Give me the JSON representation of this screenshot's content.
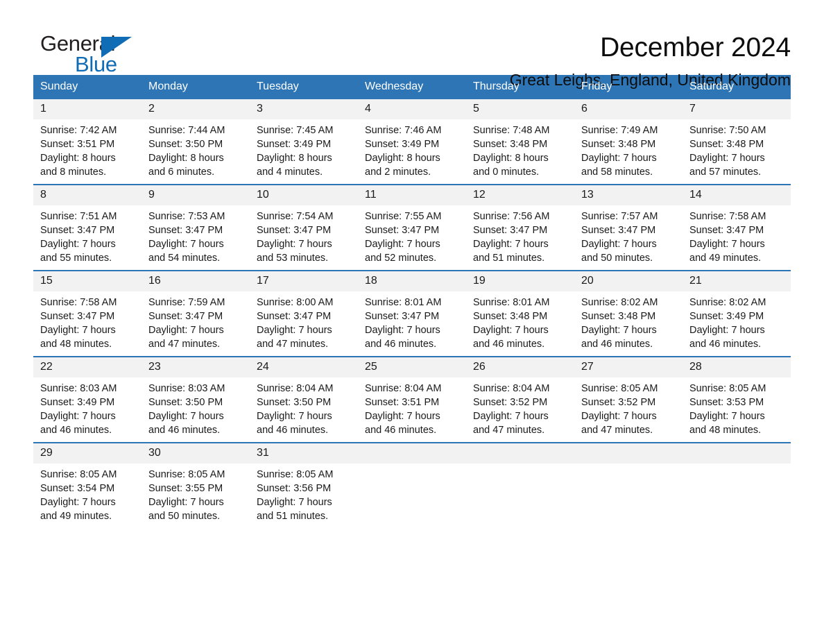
{
  "brand": {
    "name_dark": "General",
    "name_blue": "Blue",
    "accent_color": "#0f6cb5"
  },
  "header": {
    "title": "December 2024",
    "location": "Great Leighs, England, United Kingdom"
  },
  "calendar": {
    "header_color": "#2e75b6",
    "day_band_color": "#f2f2f2",
    "weekdays": [
      "Sunday",
      "Monday",
      "Tuesday",
      "Wednesday",
      "Thursday",
      "Friday",
      "Saturday"
    ],
    "weeks": [
      [
        {
          "day": "1",
          "sunrise": "Sunrise: 7:42 AM",
          "sunset": "Sunset: 3:51 PM",
          "daylight_1": "Daylight: 8 hours",
          "daylight_2": "and 8 minutes."
        },
        {
          "day": "2",
          "sunrise": "Sunrise: 7:44 AM",
          "sunset": "Sunset: 3:50 PM",
          "daylight_1": "Daylight: 8 hours",
          "daylight_2": "and 6 minutes."
        },
        {
          "day": "3",
          "sunrise": "Sunrise: 7:45 AM",
          "sunset": "Sunset: 3:49 PM",
          "daylight_1": "Daylight: 8 hours",
          "daylight_2": "and 4 minutes."
        },
        {
          "day": "4",
          "sunrise": "Sunrise: 7:46 AM",
          "sunset": "Sunset: 3:49 PM",
          "daylight_1": "Daylight: 8 hours",
          "daylight_2": "and 2 minutes."
        },
        {
          "day": "5",
          "sunrise": "Sunrise: 7:48 AM",
          "sunset": "Sunset: 3:48 PM",
          "daylight_1": "Daylight: 8 hours",
          "daylight_2": "and 0 minutes."
        },
        {
          "day": "6",
          "sunrise": "Sunrise: 7:49 AM",
          "sunset": "Sunset: 3:48 PM",
          "daylight_1": "Daylight: 7 hours",
          "daylight_2": "and 58 minutes."
        },
        {
          "day": "7",
          "sunrise": "Sunrise: 7:50 AM",
          "sunset": "Sunset: 3:48 PM",
          "daylight_1": "Daylight: 7 hours",
          "daylight_2": "and 57 minutes."
        }
      ],
      [
        {
          "day": "8",
          "sunrise": "Sunrise: 7:51 AM",
          "sunset": "Sunset: 3:47 PM",
          "daylight_1": "Daylight: 7 hours",
          "daylight_2": "and 55 minutes."
        },
        {
          "day": "9",
          "sunrise": "Sunrise: 7:53 AM",
          "sunset": "Sunset: 3:47 PM",
          "daylight_1": "Daylight: 7 hours",
          "daylight_2": "and 54 minutes."
        },
        {
          "day": "10",
          "sunrise": "Sunrise: 7:54 AM",
          "sunset": "Sunset: 3:47 PM",
          "daylight_1": "Daylight: 7 hours",
          "daylight_2": "and 53 minutes."
        },
        {
          "day": "11",
          "sunrise": "Sunrise: 7:55 AM",
          "sunset": "Sunset: 3:47 PM",
          "daylight_1": "Daylight: 7 hours",
          "daylight_2": "and 52 minutes."
        },
        {
          "day": "12",
          "sunrise": "Sunrise: 7:56 AM",
          "sunset": "Sunset: 3:47 PM",
          "daylight_1": "Daylight: 7 hours",
          "daylight_2": "and 51 minutes."
        },
        {
          "day": "13",
          "sunrise": "Sunrise: 7:57 AM",
          "sunset": "Sunset: 3:47 PM",
          "daylight_1": "Daylight: 7 hours",
          "daylight_2": "and 50 minutes."
        },
        {
          "day": "14",
          "sunrise": "Sunrise: 7:58 AM",
          "sunset": "Sunset: 3:47 PM",
          "daylight_1": "Daylight: 7 hours",
          "daylight_2": "and 49 minutes."
        }
      ],
      [
        {
          "day": "15",
          "sunrise": "Sunrise: 7:58 AM",
          "sunset": "Sunset: 3:47 PM",
          "daylight_1": "Daylight: 7 hours",
          "daylight_2": "and 48 minutes."
        },
        {
          "day": "16",
          "sunrise": "Sunrise: 7:59 AM",
          "sunset": "Sunset: 3:47 PM",
          "daylight_1": "Daylight: 7 hours",
          "daylight_2": "and 47 minutes."
        },
        {
          "day": "17",
          "sunrise": "Sunrise: 8:00 AM",
          "sunset": "Sunset: 3:47 PM",
          "daylight_1": "Daylight: 7 hours",
          "daylight_2": "and 47 minutes."
        },
        {
          "day": "18",
          "sunrise": "Sunrise: 8:01 AM",
          "sunset": "Sunset: 3:47 PM",
          "daylight_1": "Daylight: 7 hours",
          "daylight_2": "and 46 minutes."
        },
        {
          "day": "19",
          "sunrise": "Sunrise: 8:01 AM",
          "sunset": "Sunset: 3:48 PM",
          "daylight_1": "Daylight: 7 hours",
          "daylight_2": "and 46 minutes."
        },
        {
          "day": "20",
          "sunrise": "Sunrise: 8:02 AM",
          "sunset": "Sunset: 3:48 PM",
          "daylight_1": "Daylight: 7 hours",
          "daylight_2": "and 46 minutes."
        },
        {
          "day": "21",
          "sunrise": "Sunrise: 8:02 AM",
          "sunset": "Sunset: 3:49 PM",
          "daylight_1": "Daylight: 7 hours",
          "daylight_2": "and 46 minutes."
        }
      ],
      [
        {
          "day": "22",
          "sunrise": "Sunrise: 8:03 AM",
          "sunset": "Sunset: 3:49 PM",
          "daylight_1": "Daylight: 7 hours",
          "daylight_2": "and 46 minutes."
        },
        {
          "day": "23",
          "sunrise": "Sunrise: 8:03 AM",
          "sunset": "Sunset: 3:50 PM",
          "daylight_1": "Daylight: 7 hours",
          "daylight_2": "and 46 minutes."
        },
        {
          "day": "24",
          "sunrise": "Sunrise: 8:04 AM",
          "sunset": "Sunset: 3:50 PM",
          "daylight_1": "Daylight: 7 hours",
          "daylight_2": "and 46 minutes."
        },
        {
          "day": "25",
          "sunrise": "Sunrise: 8:04 AM",
          "sunset": "Sunset: 3:51 PM",
          "daylight_1": "Daylight: 7 hours",
          "daylight_2": "and 46 minutes."
        },
        {
          "day": "26",
          "sunrise": "Sunrise: 8:04 AM",
          "sunset": "Sunset: 3:52 PM",
          "daylight_1": "Daylight: 7 hours",
          "daylight_2": "and 47 minutes."
        },
        {
          "day": "27",
          "sunrise": "Sunrise: 8:05 AM",
          "sunset": "Sunset: 3:52 PM",
          "daylight_1": "Daylight: 7 hours",
          "daylight_2": "and 47 minutes."
        },
        {
          "day": "28",
          "sunrise": "Sunrise: 8:05 AM",
          "sunset": "Sunset: 3:53 PM",
          "daylight_1": "Daylight: 7 hours",
          "daylight_2": "and 48 minutes."
        }
      ],
      [
        {
          "day": "29",
          "sunrise": "Sunrise: 8:05 AM",
          "sunset": "Sunset: 3:54 PM",
          "daylight_1": "Daylight: 7 hours",
          "daylight_2": "and 49 minutes."
        },
        {
          "day": "30",
          "sunrise": "Sunrise: 8:05 AM",
          "sunset": "Sunset: 3:55 PM",
          "daylight_1": "Daylight: 7 hours",
          "daylight_2": "and 50 minutes."
        },
        {
          "day": "31",
          "sunrise": "Sunrise: 8:05 AM",
          "sunset": "Sunset: 3:56 PM",
          "daylight_1": "Daylight: 7 hours",
          "daylight_2": "and 51 minutes."
        },
        {
          "day": "",
          "sunrise": "",
          "sunset": "",
          "daylight_1": "",
          "daylight_2": ""
        },
        {
          "day": "",
          "sunrise": "",
          "sunset": "",
          "daylight_1": "",
          "daylight_2": ""
        },
        {
          "day": "",
          "sunrise": "",
          "sunset": "",
          "daylight_1": "",
          "daylight_2": ""
        },
        {
          "day": "",
          "sunrise": "",
          "sunset": "",
          "daylight_1": "",
          "daylight_2": ""
        }
      ]
    ]
  }
}
